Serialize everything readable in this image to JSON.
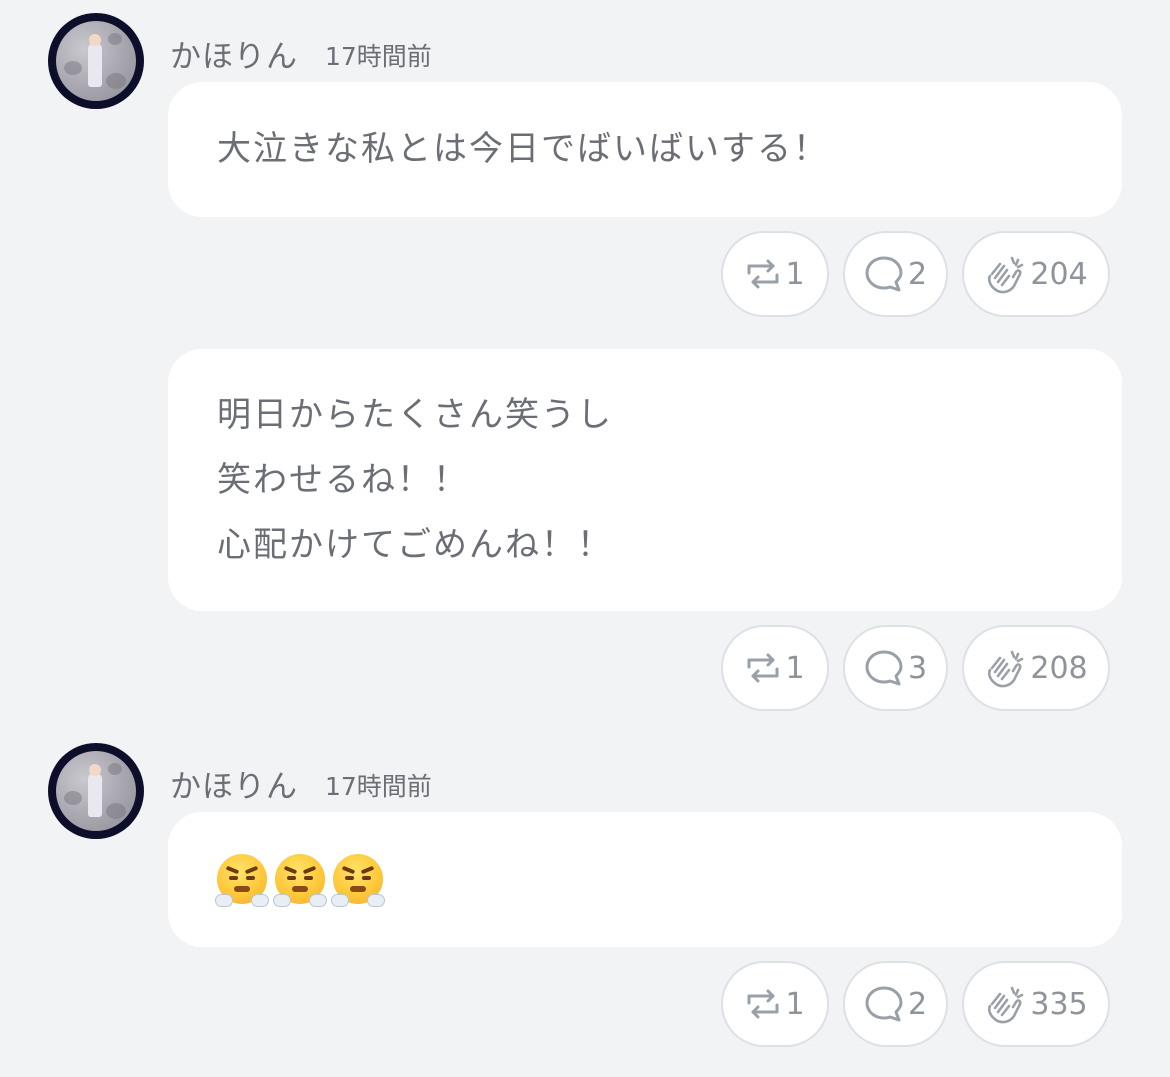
{
  "posts": [
    {
      "user": "かほりん",
      "time": "17時間前",
      "entries": [
        {
          "text": "大泣きな私とは今日でばいばいする！",
          "reposts": "1",
          "comments": "2",
          "claps": "204"
        },
        {
          "text": "明日からたくさん笑うし\n笑わせるね！！\n心配かけてごめんね！！",
          "reposts": "1",
          "comments": "3",
          "claps": "208"
        }
      ]
    },
    {
      "user": "かほりん",
      "time": "17時間前",
      "entries": [
        {
          "emoji": [
            "face-with-steam-from-nose",
            "face-with-steam-from-nose",
            "face-with-steam-from-nose"
          ],
          "reposts": "1",
          "comments": "2",
          "claps": "335"
        }
      ]
    }
  ],
  "icons": {
    "repost": "repost-icon",
    "comment": "comment-icon",
    "clap": "clap-icon"
  },
  "colors": {
    "background": "#f2f3f5",
    "bubble": "#ffffff",
    "text": "#6b6e75",
    "action_text": "#8f939a",
    "avatar_ring": "#0d0f2a"
  }
}
